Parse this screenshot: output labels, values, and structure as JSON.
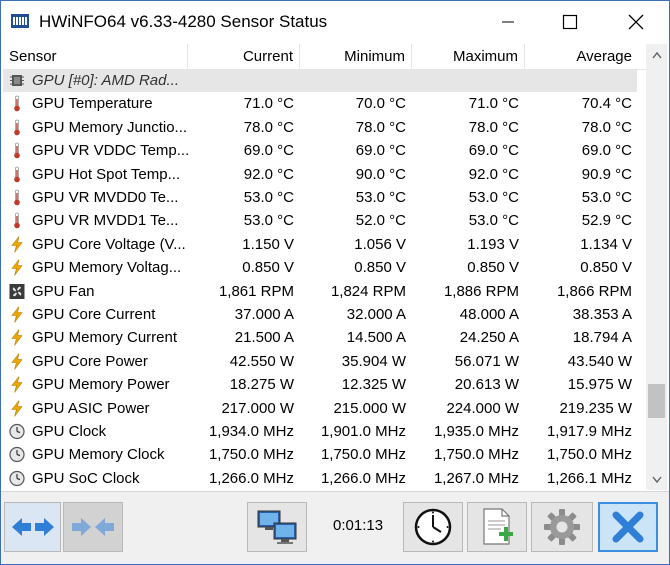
{
  "window": {
    "title": "HWiNFO64 v6.33-4280 Sensor Status"
  },
  "table": {
    "columns": [
      "Sensor",
      "Current",
      "Minimum",
      "Maximum",
      "Average"
    ],
    "rows": [
      {
        "icon": "chip-icon",
        "label": "GPU [#0]: AMD Rad...",
        "group": true,
        "cur": "",
        "min": "",
        "max": "",
        "avg": ""
      },
      {
        "icon": "thermometer-icon",
        "label": "GPU Temperature",
        "cur": "71.0 °C",
        "min": "70.0 °C",
        "max": "71.0 °C",
        "avg": "70.4 °C"
      },
      {
        "icon": "thermometer-icon",
        "label": "GPU Memory Junctio...",
        "cur": "78.0 °C",
        "min": "78.0 °C",
        "max": "78.0 °C",
        "avg": "78.0 °C"
      },
      {
        "icon": "thermometer-icon",
        "label": "GPU VR VDDC Temp...",
        "cur": "69.0 °C",
        "min": "69.0 °C",
        "max": "69.0 °C",
        "avg": "69.0 °C"
      },
      {
        "icon": "thermometer-icon",
        "label": "GPU Hot Spot Temp...",
        "cur": "92.0 °C",
        "min": "90.0 °C",
        "max": "92.0 °C",
        "avg": "90.9 °C"
      },
      {
        "icon": "thermometer-icon",
        "label": "GPU VR MVDD0 Te...",
        "cur": "53.0 °C",
        "min": "53.0 °C",
        "max": "53.0 °C",
        "avg": "53.0 °C"
      },
      {
        "icon": "thermometer-icon",
        "label": "GPU VR MVDD1 Te...",
        "cur": "53.0 °C",
        "min": "52.0 °C",
        "max": "53.0 °C",
        "avg": "52.9 °C"
      },
      {
        "icon": "lightning-icon",
        "label": "GPU Core Voltage (V...",
        "cur": "1.150 V",
        "min": "1.056 V",
        "max": "1.193 V",
        "avg": "1.134 V"
      },
      {
        "icon": "lightning-icon",
        "label": "GPU Memory Voltag...",
        "cur": "0.850 V",
        "min": "0.850 V",
        "max": "0.850 V",
        "avg": "0.850 V"
      },
      {
        "icon": "fan-icon",
        "label": "GPU Fan",
        "cur": "1,861 RPM",
        "min": "1,824 RPM",
        "max": "1,886 RPM",
        "avg": "1,866 RPM"
      },
      {
        "icon": "lightning-icon",
        "label": "GPU Core Current",
        "cur": "37.000 A",
        "min": "32.000 A",
        "max": "48.000 A",
        "avg": "38.353 A"
      },
      {
        "icon": "lightning-icon",
        "label": "GPU Memory Current",
        "cur": "21.500 A",
        "min": "14.500 A",
        "max": "24.250 A",
        "avg": "18.794 A"
      },
      {
        "icon": "lightning-icon",
        "label": "GPU Core Power",
        "cur": "42.550 W",
        "min": "35.904 W",
        "max": "56.071 W",
        "avg": "43.540 W"
      },
      {
        "icon": "lightning-icon",
        "label": "GPU Memory Power",
        "cur": "18.275 W",
        "min": "12.325 W",
        "max": "20.613 W",
        "avg": "15.975 W"
      },
      {
        "icon": "lightning-icon",
        "label": "GPU ASIC Power",
        "cur": "217.000 W",
        "min": "215.000 W",
        "max": "224.000 W",
        "avg": "219.235 W"
      },
      {
        "icon": "clock-icon",
        "label": "GPU Clock",
        "cur": "1,934.0 MHz",
        "min": "1,901.0 MHz",
        "max": "1,935.0 MHz",
        "avg": "1,917.9 MHz"
      },
      {
        "icon": "clock-icon",
        "label": "GPU Memory Clock",
        "cur": "1,750.0 MHz",
        "min": "1,750.0 MHz",
        "max": "1,750.0 MHz",
        "avg": "1,750.0 MHz"
      },
      {
        "icon": "clock-icon",
        "label": "GPU SoC Clock",
        "cur": "1,266.0 MHz",
        "min": "1,266.0 MHz",
        "max": "1,267.0 MHz",
        "avg": "1,266.1 MHz"
      }
    ]
  },
  "toolbar": {
    "timer": "0:01:13"
  },
  "colors": {
    "accent": "#3b8ee0",
    "thermo": "#c0392b",
    "bolt": "#f0a800"
  }
}
